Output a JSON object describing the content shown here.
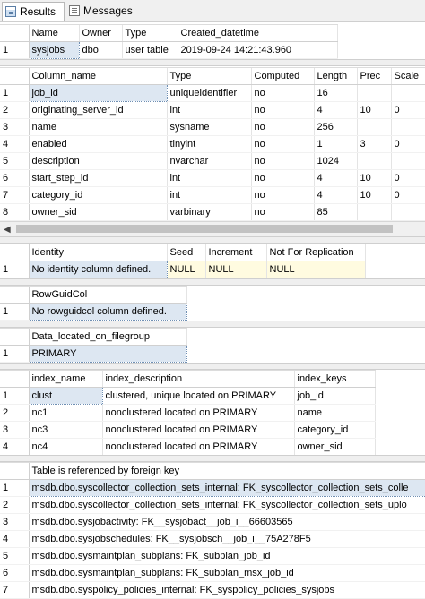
{
  "tabs": {
    "results": "Results",
    "messages": "Messages"
  },
  "grid1": {
    "headers": [
      "Name",
      "Owner",
      "Type",
      "Created_datetime"
    ],
    "rows": [
      [
        "1",
        "sysjobs",
        "dbo",
        "user table",
        "2019-09-24 14:21:43.960"
      ]
    ]
  },
  "grid2": {
    "headers": [
      "Column_name",
      "Type",
      "Computed",
      "Length",
      "Prec",
      "Scale"
    ],
    "rows": [
      [
        "1",
        "job_id",
        "uniqueidentifier",
        "no",
        "16",
        "",
        ""
      ],
      [
        "2",
        "originating_server_id",
        "int",
        "no",
        "4",
        "10",
        "0"
      ],
      [
        "3",
        "name",
        "sysname",
        "no",
        "256",
        "",
        ""
      ],
      [
        "4",
        "enabled",
        "tinyint",
        "no",
        "1",
        "3",
        "0"
      ],
      [
        "5",
        "description",
        "nvarchar",
        "no",
        "1024",
        "",
        ""
      ],
      [
        "6",
        "start_step_id",
        "int",
        "no",
        "4",
        "10",
        "0"
      ],
      [
        "7",
        "category_id",
        "int",
        "no",
        "4",
        "10",
        "0"
      ],
      [
        "8",
        "owner_sid",
        "varbinary",
        "no",
        "85",
        "",
        ""
      ]
    ]
  },
  "grid3": {
    "headers": [
      "Identity",
      "Seed",
      "Increment",
      "Not For Replication"
    ],
    "rows": [
      [
        "1",
        "No identity column defined.",
        "NULL",
        "NULL",
        "NULL"
      ]
    ]
  },
  "grid4": {
    "headers": [
      "RowGuidCol"
    ],
    "rows": [
      [
        "1",
        "No rowguidcol column defined."
      ]
    ]
  },
  "grid5": {
    "headers": [
      "Data_located_on_filegroup"
    ],
    "rows": [
      [
        "1",
        "PRIMARY"
      ]
    ]
  },
  "grid6": {
    "headers": [
      "index_name",
      "index_description",
      "index_keys"
    ],
    "rows": [
      [
        "1",
        "clust",
        "clustered, unique located on PRIMARY",
        "job_id"
      ],
      [
        "2",
        "nc1",
        "nonclustered located on PRIMARY",
        "name"
      ],
      [
        "3",
        "nc3",
        "nonclustered located on PRIMARY",
        "category_id"
      ],
      [
        "4",
        "nc4",
        "nonclustered located on PRIMARY",
        "owner_sid"
      ]
    ]
  },
  "grid7": {
    "headers": [
      "Table is referenced by foreign key"
    ],
    "rows": [
      [
        "1",
        "msdb.dbo.syscollector_collection_sets_internal: FK_syscollector_collection_sets_colle"
      ],
      [
        "2",
        "msdb.dbo.syscollector_collection_sets_internal: FK_syscollector_collection_sets_uplo"
      ],
      [
        "3",
        "msdb.dbo.sysjobactivity: FK__sysjobact__job_i__66603565"
      ],
      [
        "4",
        "msdb.dbo.sysjobschedules: FK__sysjobsch__job_i__75A278F5"
      ],
      [
        "5",
        "msdb.dbo.sysmaintplan_subplans: FK_subplan_job_id"
      ],
      [
        "6",
        "msdb.dbo.sysmaintplan_subplans: FK_subplan_msx_job_id"
      ],
      [
        "7",
        "msdb.dbo.syspolicy_policies_internal: FK_syspolicy_policies_sysjobs"
      ]
    ]
  }
}
